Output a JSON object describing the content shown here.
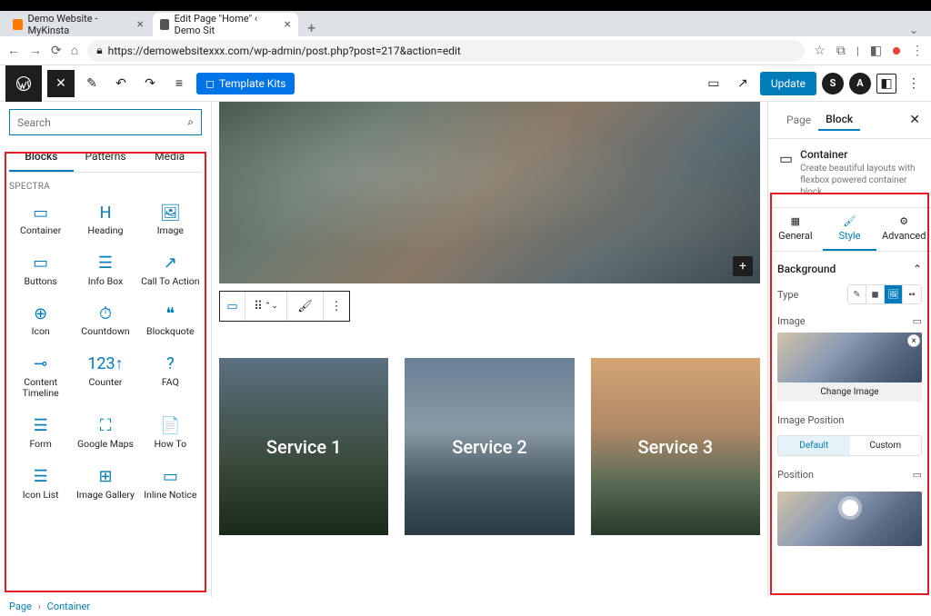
{
  "browser": {
    "tabs": [
      {
        "favicon": "#ff7a00",
        "title": "Demo Website - MyKinsta"
      },
      {
        "favicon": "#555",
        "title": "Edit Page \"Home\" ‹ Demo Sit"
      }
    ],
    "url": "https://demowebsitexxx.com/wp-admin/post.php?post=217&action=edit"
  },
  "wpbar": {
    "template_kits": "Template Kits",
    "update": "Update"
  },
  "sidebar_left": {
    "search_placeholder": "Search",
    "tabs": {
      "blocks": "Blocks",
      "patterns": "Patterns",
      "media": "Media"
    },
    "category": "SPECTRA",
    "blocks": [
      {
        "icon": "container",
        "label": "Container"
      },
      {
        "icon": "heading",
        "label": "Heading"
      },
      {
        "icon": "image",
        "label": "Image"
      },
      {
        "icon": "buttons",
        "label": "Buttons"
      },
      {
        "icon": "infobox",
        "label": "Info Box"
      },
      {
        "icon": "cta",
        "label": "Call To Action"
      },
      {
        "icon": "icon",
        "label": "Icon"
      },
      {
        "icon": "countdown",
        "label": "Countdown"
      },
      {
        "icon": "blockquote",
        "label": "Blockquote"
      },
      {
        "icon": "timeline",
        "label": "Content Timeline"
      },
      {
        "icon": "counter",
        "label": "Counter"
      },
      {
        "icon": "faq",
        "label": "FAQ"
      },
      {
        "icon": "form",
        "label": "Form"
      },
      {
        "icon": "maps",
        "label": "Google Maps"
      },
      {
        "icon": "howto",
        "label": "How To"
      },
      {
        "icon": "iconlist",
        "label": "Icon List"
      },
      {
        "icon": "gallery",
        "label": "Image Gallery"
      },
      {
        "icon": "notice",
        "label": "Inline Notice"
      }
    ]
  },
  "canvas": {
    "services": [
      "Service 1",
      "Service 2",
      "Service 3"
    ]
  },
  "sidebar_right": {
    "tabs": {
      "page": "Page",
      "block": "Block"
    },
    "block_name": "Container",
    "block_desc": "Create beautiful layouts with flexbox powered container block.",
    "tabs2": {
      "general": "General",
      "style": "Style",
      "advanced": "Advanced"
    },
    "background": "Background",
    "type": "Type",
    "image": "Image",
    "change_image": "Change Image",
    "image_position": "Image Position",
    "position": "Position",
    "default": "Default",
    "custom": "Custom"
  },
  "breadcrumb": {
    "page": "Page",
    "container": "Container"
  }
}
